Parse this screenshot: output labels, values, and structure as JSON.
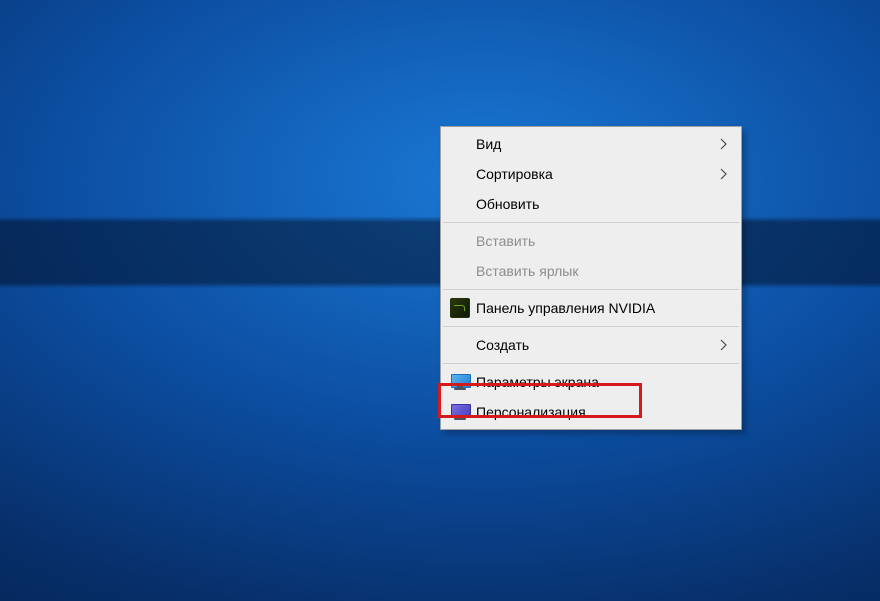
{
  "menu": {
    "items": [
      {
        "label": "Вид"
      },
      {
        "label": "Сортировка"
      },
      {
        "label": "Обновить"
      },
      {
        "label": "Вставить"
      },
      {
        "label": "Вставить ярлык"
      },
      {
        "label": "Панель управления NVIDIA"
      },
      {
        "label": "Создать"
      },
      {
        "label": "Параметры экрана"
      },
      {
        "label": "Персонализация"
      }
    ]
  }
}
